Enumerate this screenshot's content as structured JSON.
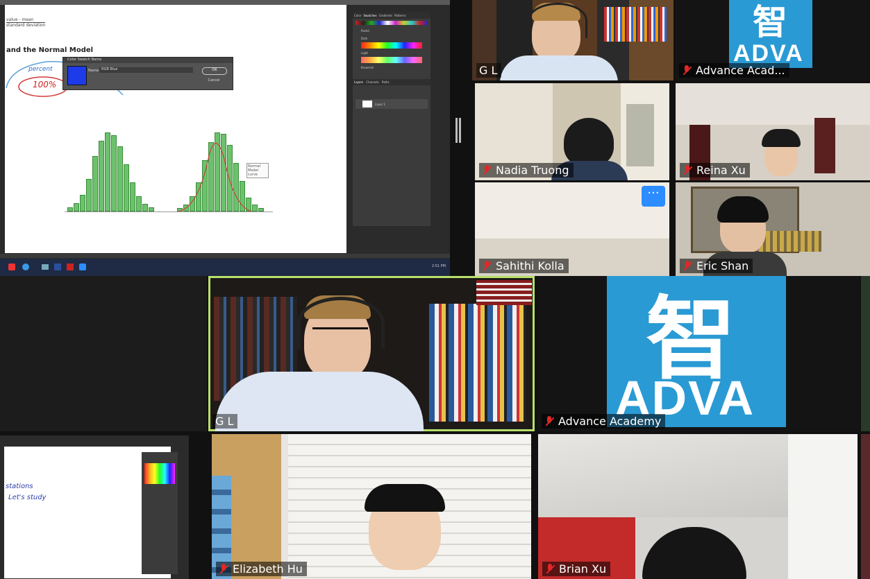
{
  "shared_screen": {
    "slide_heading": "and the Normal Model",
    "top_lines": [
      "value - mean",
      "standard deviation"
    ],
    "handwriting": [
      "percent",
      "100%"
    ],
    "dialog": {
      "title": "Color Swatch Name",
      "name_label": "Name:",
      "name_value": "RGB Blue",
      "ok_label": "OK",
      "cancel_label": "Cancel"
    },
    "annotation": "Normal Model curve",
    "panel_tabs": [
      "Color",
      "Swatches",
      "Gradients",
      "Patterns"
    ],
    "swatch_groups": [
      "Pastel",
      "Dark",
      "Light",
      "Brownish"
    ],
    "layer_tabs": [
      "Layers",
      "Channels",
      "Paths"
    ],
    "layer_name": "Layer 1",
    "clock": "2:51 PM"
  },
  "small_shared_screen": {
    "handwriting": [
      "stations",
      "Let's study"
    ]
  },
  "participants": [
    {
      "name": "G L",
      "muted": false
    },
    {
      "name": "Advance Acad...",
      "muted": true
    },
    {
      "name": "Nadia Truong",
      "muted": true
    },
    {
      "name": "Reina Xu",
      "muted": true
    },
    {
      "name": "Sahithi Kolla",
      "muted": true
    },
    {
      "name": "Eric Shan",
      "muted": true
    },
    {
      "name": "G L",
      "muted": false
    },
    {
      "name": "Advance Academy",
      "muted": true
    },
    {
      "name": "Elizabeth Hu",
      "muted": true
    },
    {
      "name": "Brian Xu",
      "muted": true
    }
  ],
  "logo": {
    "character": "智",
    "text": "ADVA"
  },
  "more_button": "···",
  "colors": {
    "active_border": "#b8e06a",
    "muted_icon": "#e02828",
    "logo_bg": "#2a9ad4",
    "zoom_blue": "#2d8cff"
  }
}
